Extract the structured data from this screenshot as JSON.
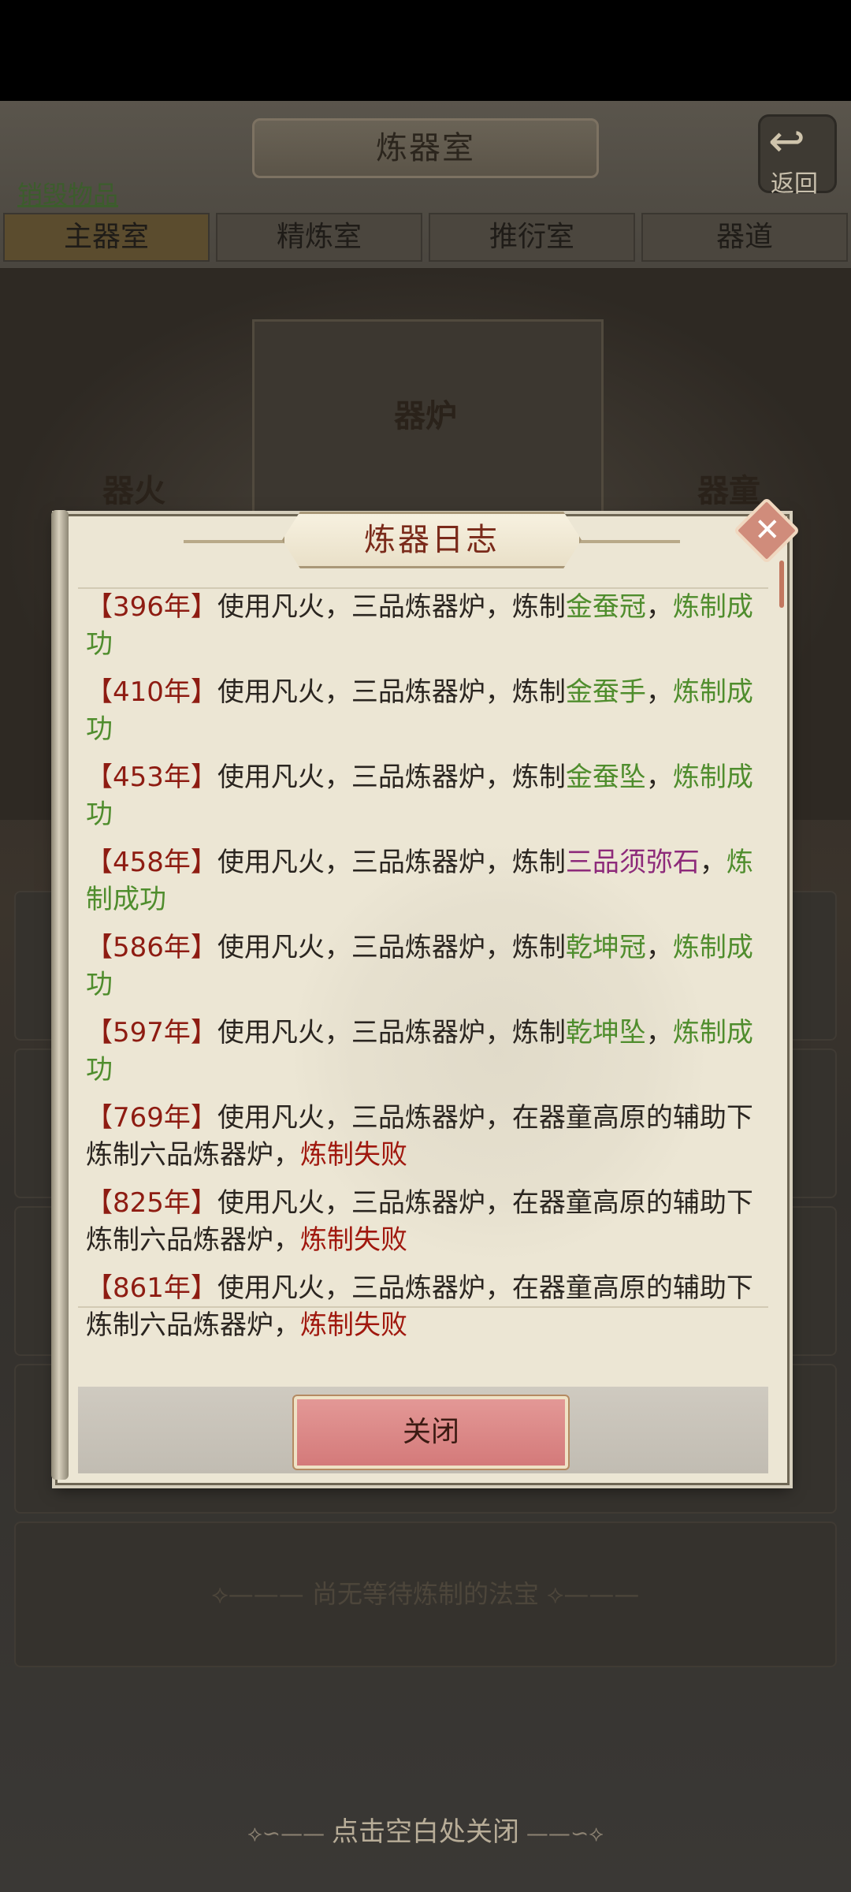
{
  "background": {
    "title": "炼器室",
    "back_label": "返回",
    "destroy_link": "销毁物品",
    "tabs": [
      "主器室",
      "精炼室",
      "推衍室",
      "器道"
    ],
    "furnace_label": "器炉",
    "fire_label": "器火",
    "boy_label": "器童",
    "pending_text": "尚无等待炼制的法宝",
    "dismiss_text": "点击空白处关闭"
  },
  "modal": {
    "title": "炼器日志",
    "close_button": "关闭",
    "entries": [
      {
        "year": "【396年】",
        "text": "使用凡火，三品炼器炉，炼制",
        "item": "金蚕冠",
        "item_color": "green",
        "sep": "，",
        "result": "炼制成功",
        "result_color": "green"
      },
      {
        "year": "【410年】",
        "text": "使用凡火，三品炼器炉，炼制",
        "item": "金蚕手",
        "item_color": "green",
        "sep": "，",
        "result": "炼制成功",
        "result_color": "green"
      },
      {
        "year": "【453年】",
        "text": "使用凡火，三品炼器炉，炼制",
        "item": "金蚕坠",
        "item_color": "green",
        "sep": "，",
        "result": "炼制成功",
        "result_color": "green"
      },
      {
        "year": "【458年】",
        "text": "使用凡火，三品炼器炉，炼制",
        "item": "三品须弥石",
        "item_color": "purple",
        "sep": "，",
        "result": "炼制成功",
        "result_color": "green"
      },
      {
        "year": "【586年】",
        "text": "使用凡火，三品炼器炉，炼制",
        "item": "乾坤冠",
        "item_color": "green",
        "sep": "，",
        "result": "炼制成功",
        "result_color": "green"
      },
      {
        "year": "【597年】",
        "text": "使用凡火，三品炼器炉，炼制",
        "item": "乾坤坠",
        "item_color": "green",
        "sep": "，",
        "result": "炼制成功",
        "result_color": "green"
      },
      {
        "year": "【769年】",
        "text": "使用凡火，三品炼器炉，在器童高原的辅助下炼制六品炼器炉",
        "item": "",
        "item_color": "",
        "sep": "，",
        "result": "炼制失败",
        "result_color": "red"
      },
      {
        "year": "【825年】",
        "text": "使用凡火，三品炼器炉，在器童高原的辅助下炼制六品炼器炉",
        "item": "",
        "item_color": "",
        "sep": "，",
        "result": "炼制失败",
        "result_color": "red"
      },
      {
        "year": "【861年】",
        "text": "使用凡火，三品炼器炉，在器童高原的辅助下炼制六品炼器炉",
        "item": "",
        "item_color": "",
        "sep": "，",
        "result": "炼制失败",
        "result_color": "red"
      }
    ]
  },
  "colors": {
    "year": "#8e1c12",
    "green": "#4f8d2d",
    "purple": "#8d2a7a",
    "red": "#a0180e"
  }
}
